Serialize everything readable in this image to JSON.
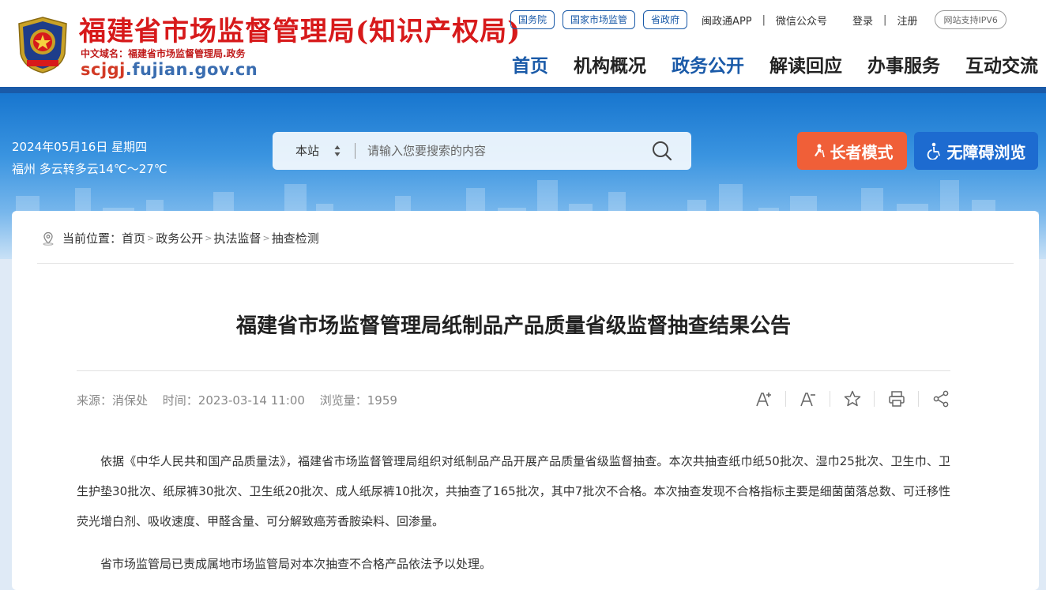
{
  "header": {
    "title": "福建省市场监督管理局(知识产权局)",
    "domain_cn": "中文域名：福建省市场监督管理局.政务",
    "url_part1": "scjgj",
    "url_part2": ".fujian.gov.cn",
    "top_links": {
      "guowuyuan": "国务院",
      "guojia": "国家市场监管",
      "shengzhengfu": "省政府",
      "minzhengtong": "闽政通APP",
      "weixin": "微信公众号",
      "login": "登录",
      "register": "注册",
      "ipv6": "网站支持IPV6"
    },
    "nav": [
      "首页",
      "机构概况",
      "政务公开",
      "解读回应",
      "办事服务",
      "互动交流"
    ]
  },
  "banner": {
    "date": "2024年05月16日 星期四",
    "weather": "福州 多云转多云14℃～27℃",
    "search_scope": "本站",
    "search_placeholder": "请输入您要搜索的内容",
    "elder_mode": "长者模式",
    "accessible": "无障碍浏览"
  },
  "breadcrumb": {
    "label": "当前位置：",
    "items": [
      "首页",
      "政务公开",
      "执法监督",
      "抽查检测"
    ]
  },
  "article": {
    "title": "福建省市场监督管理局纸制品产品质量省级监督抽查结果公告",
    "source": "来源：消保处",
    "time": "时间：2023-03-14 11:00",
    "views": "浏览量：1959",
    "para1": "依据《中华人民共和国产品质量法》，福建省市场监督管理局组织对纸制品产品开展产品质量省级监督抽查。本次共抽查纸巾纸50批次、湿巾25批次、卫生巾、卫生护垫30批次、纸尿裤30批次、卫生纸20批次、成人纸尿裤10批次，共抽查了165批次，其中7批次不合格。本次抽查发现不合格指标主要是细菌菌落总数、可迁移性荧光增白剂、吸收速度、甲醛含量、可分解致癌芳香胺染料、回渗量。",
    "para2": "省市场监管局已责成属地市场监管局对本次抽查不合格产品依法予以处理。"
  },
  "colors": {
    "primary": "#1a5aa8",
    "title_red": "#d71a1b",
    "elder_orange": "#f05f38",
    "access_blue": "#1d6bd0"
  },
  "icons": [
    "emblem-icon",
    "sort-arrows-icon",
    "search-icon",
    "elder-icon",
    "wheelchair-icon",
    "location-icon",
    "font-increase-icon",
    "font-decrease-icon",
    "star-icon",
    "print-icon",
    "share-icon"
  ]
}
